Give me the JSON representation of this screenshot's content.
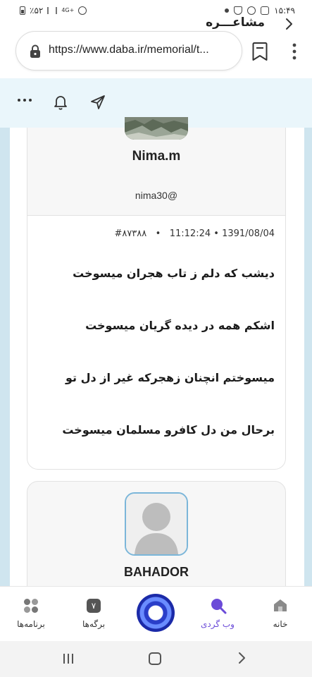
{
  "status_bar": {
    "time": "۱۵:۴۹",
    "battery": "٪۵۲",
    "network": "4G+"
  },
  "browser": {
    "url": "https://www.daba.ir/memorial/t...",
    "icons": [
      "lock-icon",
      "bookmark-icon",
      "more-vertical-icon"
    ]
  },
  "header": {
    "title": "مشاعـــره",
    "icons": [
      "chevron-right-icon",
      "send-icon",
      "bell-icon",
      "more-horizontal-icon"
    ]
  },
  "post": {
    "author_name": "Nima.m",
    "author_handle": "nima30@",
    "date": "1391/08/04",
    "time": "11:12:24",
    "post_id": "#۸۷۳۸۸",
    "verses": [
      "دیشب که دلم ز تاب هجران میسوخت",
      "اشکم همه در دیده گریان میسوخت",
      "میسوختم انچنان زهجرکه غیر از دل تو",
      "برحال من دل کافرو مسلمان میسوخت"
    ]
  },
  "next_card": {
    "author_name": "BAHADOR"
  },
  "bottom_nav": {
    "items": [
      {
        "label": "خانه",
        "icon": "home-icon"
      },
      {
        "label": "وب گردی",
        "icon": "search-icon"
      },
      {
        "label": "برگه‌ها",
        "icon": "tabs-icon",
        "count": "۷"
      },
      {
        "label": "برنامه‌ها",
        "icon": "apps-icon"
      }
    ],
    "active_color": "#6b4bd8"
  },
  "colors": {
    "header_bg": "#eaf6fb",
    "page_side_bg": "#cfe5ef",
    "avatar_border": "#7bb6d9"
  }
}
